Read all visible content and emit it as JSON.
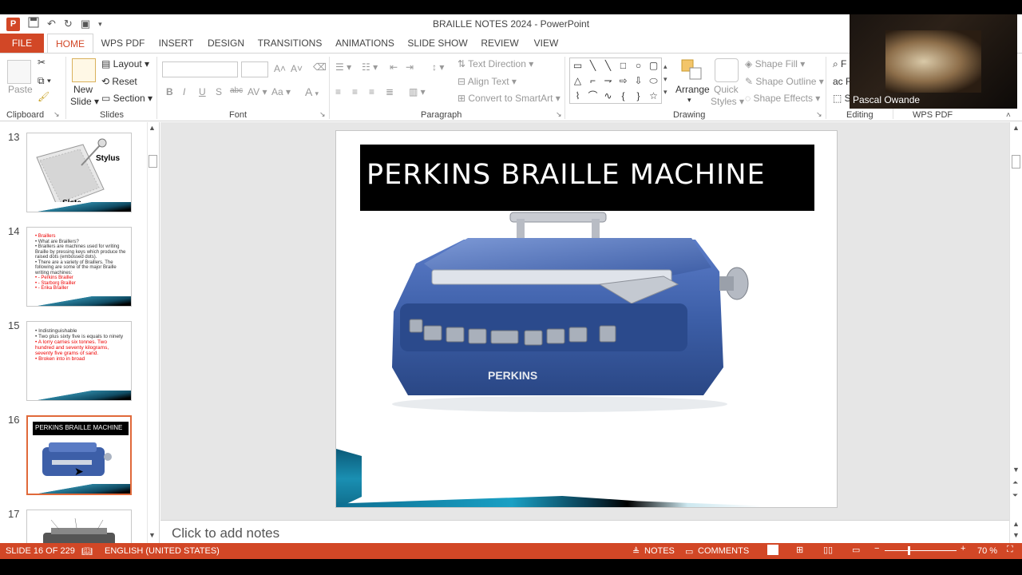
{
  "window": {
    "title": "BRAILLE NOTES 2024 - PowerPoint",
    "app_icon": "P"
  },
  "qat": {
    "save_icon": "save-icon",
    "undo_icon": "undo-icon",
    "redo_icon": "redo-icon",
    "start_icon": "presentation-icon"
  },
  "tabs": [
    "FILE",
    "HOME",
    "WPS PDF",
    "INSERT",
    "DESIGN",
    "TRANSITIONS",
    "ANIMATIONS",
    "SLIDE SHOW",
    "REVIEW",
    "VIEW"
  ],
  "ribbon": {
    "clipboard": {
      "paste": "Paste",
      "label": "Clipboard"
    },
    "slides": {
      "new_slide_1": "New",
      "new_slide_2": "Slide",
      "layout": "Layout",
      "reset": "Reset",
      "section": "Section",
      "label": "Slides"
    },
    "font": {
      "label": "Font",
      "bold": "B",
      "italic": "I",
      "underline": "U",
      "shadow": "S",
      "strike": "abc",
      "spacing": "AV",
      "case": "Aa",
      "color": "A",
      "grow": "A",
      "shrink": "A"
    },
    "paragraph": {
      "label": "Paragraph",
      "text_direction": "Text Direction",
      "align_text": "Align Text",
      "smartart": "Convert to SmartArt"
    },
    "drawing": {
      "label": "Drawing",
      "arrange": "Arrange",
      "quick_styles_1": "Quick",
      "quick_styles_2": "Styles",
      "shape_fill": "Shape Fill",
      "shape_outline": "Shape Outline",
      "shape_effects": "Shape Effects"
    },
    "editing": {
      "label": "Editing"
    },
    "wps_pdf": {
      "label": "WPS PDF"
    }
  },
  "shapes": [
    "▭",
    "╲",
    "╲",
    "□",
    "○",
    "▢",
    "△",
    "⌐",
    "⇁",
    "⇨",
    "⇩",
    "⬭",
    "⌇",
    "⌒",
    "∿",
    "{",
    "}",
    "☆"
  ],
  "thumbnails": [
    {
      "num": "13",
      "label_a": "Stylus",
      "label_b": "Slate"
    },
    {
      "num": "14",
      "lines": [
        "• Braillers",
        "• What are Braillers?",
        "• Braillers are machines used for writing Braille by pressing keys which produce the raised dots (embossed dots).",
        "• There are a variety of Braillers. The following are some of the major Braille writing machines:",
        "• - Perkins Brailler",
        "• - Starborg Brailler",
        "• - Erika Brailler"
      ]
    },
    {
      "num": "15",
      "lines": [
        "• Indistinguishable",
        "• Two plus sixty five is equals to ninety",
        "• A lorry carries six tonnes. Two hundred and seventy kilograms, seventy five grams of sand.",
        "• Broken into in broad"
      ]
    },
    {
      "num": "16",
      "title": "PERKINS BRAILLE MACHINE"
    },
    {
      "num": "17"
    }
  ],
  "slide": {
    "title": "PERKINS BRAILLE MACHINE",
    "image_alt": "Blue Perkins Braille writing machine",
    "machine_label": "PERKINS"
  },
  "notes": {
    "placeholder": "Click to add notes"
  },
  "status": {
    "slide": "SLIDE 16 OF 229",
    "language": "ENGLISH (UNITED STATES)",
    "notes": "NOTES",
    "comments": "COMMENTS",
    "zoom": "70 %"
  },
  "webcam": {
    "name": "Pascal Owande"
  },
  "colors": {
    "accent": "#d24726",
    "slide_title_bg": "#000000",
    "machine_blue": "#3d5fa8"
  }
}
